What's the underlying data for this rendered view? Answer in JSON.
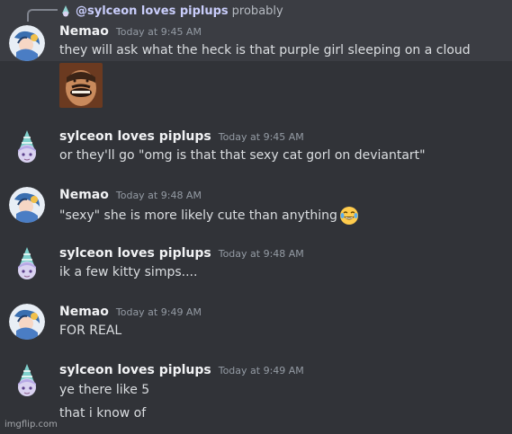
{
  "reply": {
    "author": "@sylceon loves piplups",
    "text": "probably"
  },
  "messages": [
    {
      "author": "Nemao",
      "timestamp": "Today at 9:45 AM",
      "lines": [
        "they will ask what the heck is that purple girl sleeping on  a cloud"
      ],
      "avatar": "nemao-avatar"
    },
    {
      "author": "sylceon loves piplups",
      "timestamp": "Today at 9:45 AM",
      "lines": [
        "or they'll go \"omg is that that sexy cat gorl on deviantart\""
      ],
      "avatar": "sylceon-avatar"
    },
    {
      "author": "Nemao",
      "timestamp": "Today at 9:48 AM",
      "lines": [
        "\"sexy\" she is more likely cute than anything"
      ],
      "emoji": "joy-laughing-emoji",
      "avatar": "nemao-avatar"
    },
    {
      "author": "sylceon loves piplups",
      "timestamp": "Today at 9:48 AM",
      "lines": [
        "ik a few kitty simps...."
      ],
      "avatar": "sylceon-avatar"
    },
    {
      "author": "Nemao",
      "timestamp": "Today at 9:49 AM",
      "lines": [
        "FOR REAL"
      ],
      "avatar": "nemao-avatar"
    },
    {
      "author": "sylceon loves piplups",
      "timestamp": "Today at 9:49 AM",
      "lines": [
        "ye there like 5",
        "that i know of"
      ],
      "avatar": "sylceon-avatar"
    }
  ],
  "watermark": "imgflip.com",
  "colors": {
    "background": "#313338",
    "highlight": "#3b3d43",
    "author": "#f2f3f5",
    "timestamp": "#949ba4",
    "text": "#dbdee1"
  }
}
